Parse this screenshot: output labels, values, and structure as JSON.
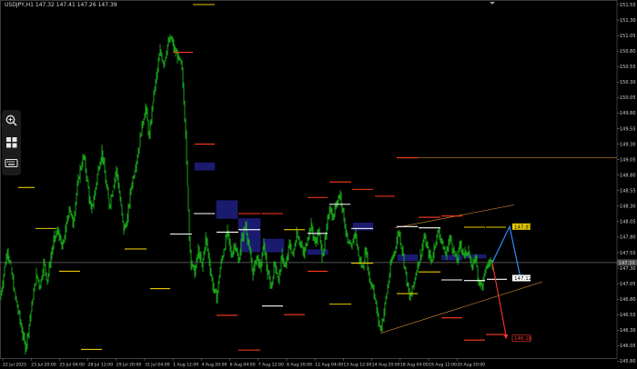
{
  "header": {
    "symbol_info": "USDJPY,H1  147.32 147.41 147.26 147.39"
  },
  "toolbar": {
    "items": [
      {
        "name": "zoom-in-icon"
      },
      {
        "name": "grid-layout-icon"
      },
      {
        "name": "keyboard-icon"
      }
    ]
  },
  "colors": {
    "background": "#000000",
    "candles": "#1bb21b",
    "zone_fill": "#1a1a6e",
    "level_yellow": "#e6c800",
    "level_white": "#ffffff",
    "level_red": "#ff3a1a",
    "projection_blue": "#2e8bff",
    "projection_red": "#ff3333",
    "channel_orange": "#c8842a",
    "current_price_line": "#6e6e6e"
  },
  "chart_data": {
    "type": "candlestick",
    "symbol": "USDJPY",
    "timeframe": "H1",
    "ohlc_header": {
      "open": 147.32,
      "high": 147.41,
      "low": 147.26,
      "close": 147.39
    },
    "current_price": 147.39,
    "ylim": [
      145.85,
      151.55
    ],
    "y_ticks": [
      "151.55",
      "151.30",
      "151.05",
      "150.80",
      "150.55",
      "150.30",
      "150.05",
      "149.80",
      "149.55",
      "149.30",
      "149.05",
      "148.80",
      "148.55",
      "148.30",
      "148.05",
      "147.80",
      "147.55",
      "147.30",
      "147.05",
      "146.80",
      "146.55",
      "146.30",
      "146.05",
      "145.80"
    ],
    "x_ticks": [
      "22 Jul 2025",
      "23 Jul 20:00",
      "25 Jul 04:00",
      "28 Jul 12:00",
      "29 Jul 20:00",
      "31 Jul 04:00",
      "1 Aug 12:00",
      "4 Aug 20:00",
      "6 Aug 04:00",
      "7 Aug 12:00",
      "8 Aug 20:00",
      "12 Aug 04:00",
      "13 Aug 12:00",
      "14 Aug 20:00",
      "18 Aug 04:00",
      "19 Aug 12:00",
      "20 Aug 20:00"
    ],
    "close_path": [
      [
        0,
        146.8
      ],
      [
        4,
        147.2
      ],
      [
        8,
        147.6
      ],
      [
        12,
        147.3
      ],
      [
        16,
        146.9
      ],
      [
        20,
        146.6
      ],
      [
        24,
        146.3
      ],
      [
        28,
        146.0
      ],
      [
        32,
        146.4
      ],
      [
        36,
        146.8
      ],
      [
        40,
        147.2
      ],
      [
        44,
        147.0
      ],
      [
        48,
        147.4
      ],
      [
        52,
        147.1
      ],
      [
        56,
        147.5
      ],
      [
        60,
        147.8
      ],
      [
        64,
        147.9
      ],
      [
        68,
        147.6
      ],
      [
        72,
        147.9
      ],
      [
        76,
        148.3
      ],
      [
        80,
        148.0
      ],
      [
        84,
        148.5
      ],
      [
        88,
        148.9
      ],
      [
        92,
        149.1
      ],
      [
        96,
        148.7
      ],
      [
        100,
        148.2
      ],
      [
        104,
        148.5
      ],
      [
        108,
        148.9
      ],
      [
        112,
        149.2
      ],
      [
        116,
        148.7
      ],
      [
        120,
        148.3
      ],
      [
        124,
        148.6
      ],
      [
        128,
        148.9
      ],
      [
        132,
        148.4
      ],
      [
        136,
        147.9
      ],
      [
        140,
        148.1
      ],
      [
        144,
        148.6
      ],
      [
        148,
        148.9
      ],
      [
        152,
        149.2
      ],
      [
        156,
        149.6
      ],
      [
        160,
        149.9
      ],
      [
        164,
        149.4
      ],
      [
        168,
        150.0
      ],
      [
        172,
        150.4
      ],
      [
        176,
        150.8
      ],
      [
        180,
        150.6
      ],
      [
        184,
        150.9
      ],
      [
        188,
        151.0
      ],
      [
        192,
        150.8
      ],
      [
        196,
        150.7
      ],
      [
        200,
        150.5
      ],
      [
        204,
        149.5
      ],
      [
        206,
        148.6
      ],
      [
        208,
        147.8
      ],
      [
        210,
        147.4
      ],
      [
        214,
        147.2
      ],
      [
        218,
        147.6
      ],
      [
        222,
        147.3
      ],
      [
        226,
        147.8
      ],
      [
        230,
        147.4
      ],
      [
        234,
        147.0
      ],
      [
        238,
        146.8
      ],
      [
        242,
        147.3
      ],
      [
        246,
        147.6
      ],
      [
        250,
        147.9
      ],
      [
        254,
        147.5
      ],
      [
        258,
        147.7
      ],
      [
        262,
        147.4
      ],
      [
        266,
        147.8
      ],
      [
        270,
        148.0
      ],
      [
        274,
        147.6
      ],
      [
        278,
        147.2
      ],
      [
        282,
        147.5
      ],
      [
        286,
        147.3
      ],
      [
        290,
        147.7
      ],
      [
        294,
        147.2
      ],
      [
        298,
        147.0
      ],
      [
        302,
        147.4
      ],
      [
        306,
        147.1
      ],
      [
        310,
        147.5
      ],
      [
        314,
        147.3
      ],
      [
        318,
        147.7
      ],
      [
        322,
        147.5
      ],
      [
        326,
        147.9
      ],
      [
        330,
        147.7
      ],
      [
        334,
        147.5
      ],
      [
        338,
        147.8
      ],
      [
        342,
        148.0
      ],
      [
        346,
        147.7
      ],
      [
        350,
        147.9
      ],
      [
        354,
        147.5
      ],
      [
        358,
        147.8
      ],
      [
        362,
        148.3
      ],
      [
        366,
        148.1
      ],
      [
        370,
        148.4
      ],
      [
        374,
        148.5
      ],
      [
        378,
        148.1
      ],
      [
        382,
        147.7
      ],
      [
        386,
        147.6
      ],
      [
        390,
        147.9
      ],
      [
        394,
        147.5
      ],
      [
        398,
        147.3
      ],
      [
        402,
        147.6
      ],
      [
        406,
        147.1
      ],
      [
        410,
        147.0
      ],
      [
        414,
        146.6
      ],
      [
        418,
        146.3
      ],
      [
        422,
        146.6
      ],
      [
        426,
        147.0
      ],
      [
        430,
        147.4
      ],
      [
        434,
        147.6
      ],
      [
        438,
        147.9
      ],
      [
        442,
        147.6
      ],
      [
        446,
        147.2
      ],
      [
        450,
        146.8
      ],
      [
        454,
        147.0
      ],
      [
        458,
        147.3
      ],
      [
        462,
        147.5
      ],
      [
        466,
        147.8
      ],
      [
        470,
        147.6
      ],
      [
        474,
        147.4
      ],
      [
        478,
        147.7
      ],
      [
        482,
        147.9
      ],
      [
        486,
        147.7
      ],
      [
        490,
        147.5
      ],
      [
        494,
        147.8
      ],
      [
        498,
        147.6
      ],
      [
        502,
        147.4
      ],
      [
        506,
        147.7
      ],
      [
        510,
        147.5
      ],
      [
        514,
        147.6
      ],
      [
        518,
        147.3
      ],
      [
        522,
        147.5
      ],
      [
        526,
        147.1
      ],
      [
        530,
        147.0
      ],
      [
        534,
        147.3
      ],
      [
        538,
        147.4
      ],
      [
        541,
        147.39
      ]
    ],
    "zones": [
      {
        "x1": 214,
        "x2": 236,
        "y_top": 149.0,
        "y_bottom": 148.88
      },
      {
        "x1": 238,
        "x2": 261,
        "y_top": 148.39,
        "y_bottom": 148.1
      },
      {
        "x1": 262,
        "x2": 286,
        "y_top": 148.1,
        "y_bottom": 147.93
      },
      {
        "x1": 264,
        "x2": 286,
        "y_top": 147.93,
        "y_bottom": 147.56
      },
      {
        "x1": 289,
        "x2": 312,
        "y_top": 147.77,
        "y_bottom": 147.56
      },
      {
        "x1": 338,
        "x2": 360,
        "y_top": 147.6,
        "y_bottom": 147.52
      },
      {
        "x1": 388,
        "x2": 410,
        "y_top": 148.03,
        "y_bottom": 147.91
      },
      {
        "x1": 437,
        "x2": 459,
        "y_top": 147.52,
        "y_bottom": 147.42
      },
      {
        "x1": 485,
        "x2": 508,
        "y_top": 147.51,
        "y_bottom": 147.43
      },
      {
        "x1": 511,
        "x2": 534,
        "y_top": 147.52,
        "y_bottom": 147.46
      }
    ],
    "levels": {
      "yellow": [
        {
          "x1": 212,
          "x2": 236,
          "y": 151.55
        },
        {
          "x1": 20,
          "x2": 38,
          "y": 148.6
        },
        {
          "x1": 39,
          "x2": 62,
          "y": 147.94
        },
        {
          "x1": 65,
          "x2": 88,
          "y": 147.25
        },
        {
          "x1": 89,
          "x2": 112,
          "y": 145.99
        },
        {
          "x1": 137,
          "x2": 161,
          "y": 147.61
        },
        {
          "x1": 165,
          "x2": 187,
          "y": 146.97
        },
        {
          "x1": 187,
          "x2": 211,
          "y": 147.85
        },
        {
          "x1": 312,
          "x2": 335,
          "y": 147.92
        },
        {
          "x1": 362,
          "x2": 386,
          "y": 146.72
        },
        {
          "x1": 386,
          "x2": 410,
          "y": 147.38
        },
        {
          "x1": 436,
          "x2": 459,
          "y": 146.89
        },
        {
          "x1": 460,
          "x2": 484,
          "y": 147.24
        },
        {
          "x1": 510,
          "x2": 533,
          "y": 147.96
        },
        {
          "x1": 534,
          "x2": 556,
          "y": 147.96
        }
      ],
      "white": [
        {
          "x1": 187,
          "x2": 211,
          "y": 147.85
        },
        {
          "x1": 213,
          "x2": 236,
          "y": 148.18
        },
        {
          "x1": 238,
          "x2": 262,
          "y": 147.88
        },
        {
          "x1": 262,
          "x2": 286,
          "y": 147.92
        },
        {
          "x1": 288,
          "x2": 311,
          "y": 146.69
        },
        {
          "x1": 338,
          "x2": 360,
          "y": 147.86
        },
        {
          "x1": 362,
          "x2": 385,
          "y": 148.33
        },
        {
          "x1": 386,
          "x2": 410,
          "y": 147.94
        },
        {
          "x1": 436,
          "x2": 459,
          "y": 147.97
        },
        {
          "x1": 460,
          "x2": 484,
          "y": 147.95
        },
        {
          "x1": 485,
          "x2": 508,
          "y": 147.11
        },
        {
          "x1": 510,
          "x2": 533,
          "y": 147.1
        },
        {
          "x1": 535,
          "x2": 557,
          "y": 147.12
        }
      ],
      "red": [
        {
          "x1": 190,
          "x2": 212,
          "y": 150.78
        },
        {
          "x1": 214,
          "x2": 236,
          "y": 149.3
        },
        {
          "x1": 238,
          "x2": 261,
          "y": 146.54
        },
        {
          "x1": 262,
          "x2": 286,
          "y": 148.18
        },
        {
          "x1": 262,
          "x2": 286,
          "y": 145.98
        },
        {
          "x1": 287,
          "x2": 311,
          "y": 148.18
        },
        {
          "x1": 312,
          "x2": 335,
          "y": 146.55
        },
        {
          "x1": 338,
          "x2": 360,
          "y": 148.44
        },
        {
          "x1": 338,
          "x2": 360,
          "y": 147.25
        },
        {
          "x1": 362,
          "x2": 386,
          "y": 148.69
        },
        {
          "x1": 387,
          "x2": 410,
          "y": 148.57
        },
        {
          "x1": 412,
          "x2": 434,
          "y": 148.46
        },
        {
          "x1": 436,
          "x2": 459,
          "y": 149.08
        },
        {
          "x1": 460,
          "x2": 484,
          "y": 148.12
        },
        {
          "x1": 485,
          "x2": 508,
          "y": 148.14
        },
        {
          "x1": 485,
          "x2": 508,
          "y": 146.5
        },
        {
          "x1": 510,
          "x2": 533,
          "y": 146.14
        },
        {
          "x1": 534,
          "x2": 556,
          "y": 146.23
        }
      ]
    },
    "horizontal_lines": [
      {
        "y": 149.08,
        "x1": 436,
        "x2": 678,
        "color": "#c8842a"
      },
      {
        "y": 147.39,
        "x1": 0,
        "x2": 678,
        "color": "#6e6e6e"
      }
    ],
    "channel": {
      "upper": [
        [
          434,
          147.95
        ],
        [
          565,
          148.32
        ]
      ],
      "lower": [
        [
          418,
          146.25
        ],
        [
          596,
          147.08
        ]
      ]
    },
    "projection": {
      "path": [
        [
          541,
          147.39
        ],
        [
          560,
          147.97
        ],
        [
          572,
          147.14
        ]
      ],
      "down": [
        [
          541,
          147.39
        ],
        [
          556,
          146.17
        ]
      ],
      "labels": [
        {
          "text": "147.97",
          "x": 563,
          "y": 147.97,
          "bg": "#e6c800",
          "fg": "#000000"
        },
        {
          "text": "147.12",
          "x": 563,
          "y": 147.14,
          "bg": "#ffffff",
          "fg": "#000000"
        },
        {
          "text": "146.18",
          "x": 563,
          "y": 146.17,
          "bg": "#000000",
          "fg": "#ff3333"
        }
      ]
    }
  }
}
